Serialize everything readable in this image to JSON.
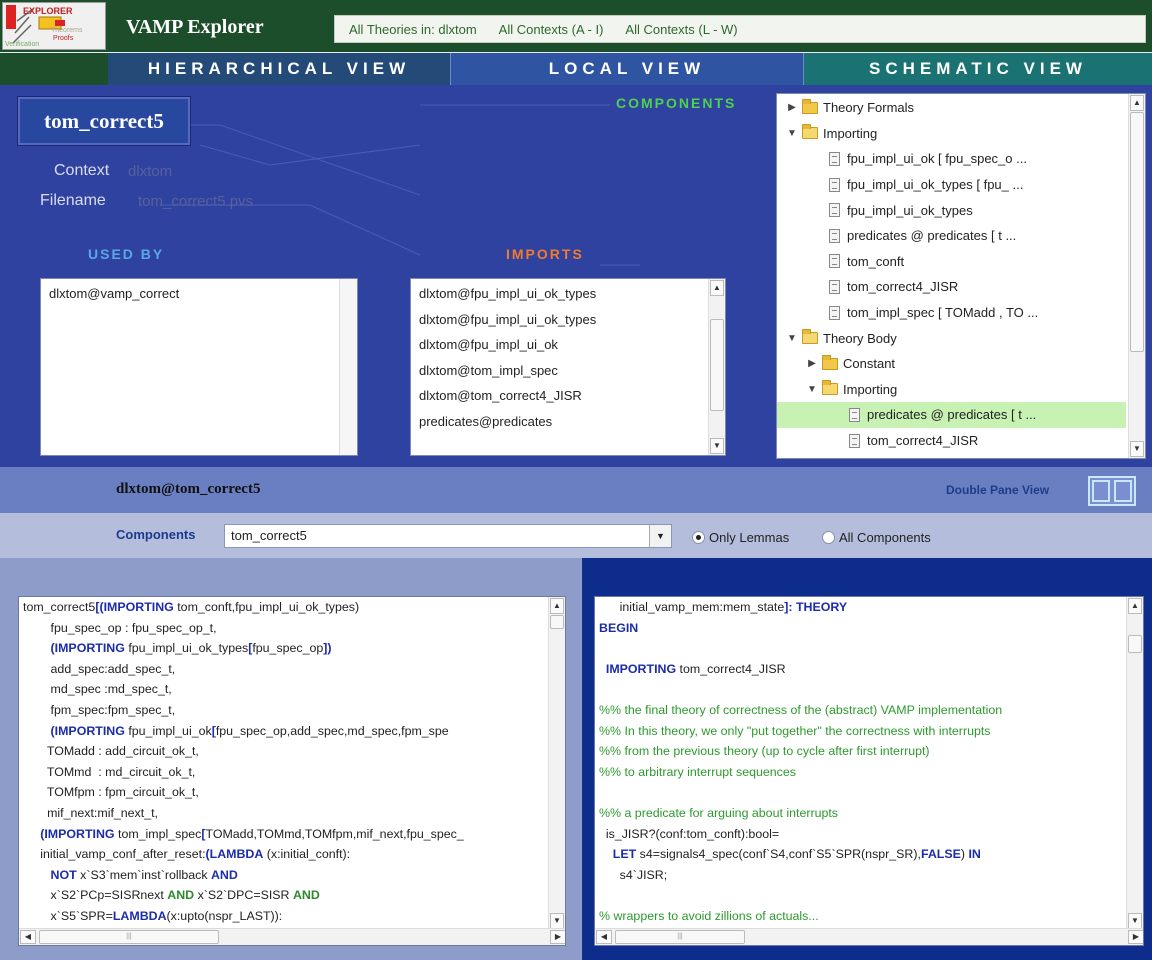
{
  "app": {
    "logo_text": "EXPLORER",
    "logo_sub1": "Theorems",
    "logo_sub2": "Proofs",
    "logo_sub3": "Verification",
    "title": "VAMP Explorer"
  },
  "top_links": [
    "All Theories in: dlxtom",
    "All Contexts (A - I)",
    "All Contexts (L - W)"
  ],
  "tabs": {
    "hierarchical": "HIERARCHICAL VIEW",
    "local": "LOCAL VIEW",
    "schematic": "SCHEMATIC VIEW"
  },
  "theory": {
    "name": "tom_correct5",
    "context_label": "Context",
    "context_value": "dlxtom",
    "filename_label": "Filename",
    "filename_value": "tom_correct5.pvs"
  },
  "sections": {
    "components": "COMPONENTS",
    "used_by": "USED BY",
    "imports": "IMPORTS"
  },
  "used_by": [
    "dlxtom@vamp_correct"
  ],
  "imports": [
    "dlxtom@fpu_impl_ui_ok_types",
    "dlxtom@fpu_impl_ui_ok_types",
    "dlxtom@fpu_impl_ui_ok",
    "dlxtom@tom_impl_spec",
    "dlxtom@tom_correct4_JISR",
    "predicates@predicates"
  ],
  "tree": [
    {
      "label": "Theory Formals",
      "kind": "folder",
      "depth": 0,
      "expanded": false
    },
    {
      "label": "Importing",
      "kind": "folder",
      "depth": 0,
      "expanded": true
    },
    {
      "label": "fpu_impl_ui_ok [ fpu_spec_o ...",
      "kind": "doc",
      "depth": 1
    },
    {
      "label": "fpu_impl_ui_ok_types [ fpu_ ...",
      "kind": "doc",
      "depth": 1
    },
    {
      "label": "fpu_impl_ui_ok_types",
      "kind": "doc",
      "depth": 1
    },
    {
      "label": "predicates @ predicates [ t ...",
      "kind": "doc",
      "depth": 1
    },
    {
      "label": "tom_conft",
      "kind": "doc",
      "depth": 1
    },
    {
      "label": "tom_correct4_JISR",
      "kind": "doc",
      "depth": 1
    },
    {
      "label": "tom_impl_spec [ TOMadd , TO ...",
      "kind": "doc",
      "depth": 1
    },
    {
      "label": "Theory Body",
      "kind": "folder",
      "depth": 0,
      "expanded": true
    },
    {
      "label": "Constant",
      "kind": "folder",
      "depth": 1,
      "expanded": false
    },
    {
      "label": "Importing",
      "kind": "folder",
      "depth": 1,
      "expanded": true
    },
    {
      "label": "predicates @ predicates [ t ...",
      "kind": "doc",
      "depth": 2,
      "selected": true
    },
    {
      "label": "tom_correct4_JISR",
      "kind": "doc",
      "depth": 2
    }
  ],
  "pane": {
    "title": "dlxtom@tom_correct5",
    "double_pane_label": "Double Pane View"
  },
  "components_bar": {
    "label": "Components",
    "selected": "tom_correct5",
    "radio_lemmas": "Only Lemmas",
    "radio_all": "All Components"
  },
  "left_code": [
    [
      {
        "t": "tom_correct5"
      },
      {
        "t": "[(",
        "c": "kw"
      },
      {
        "t": "IMPORTING",
        "c": "kw"
      },
      {
        "t": " tom_conft,fpu_impl_ui_ok_types)"
      }
    ],
    [
      {
        "t": "        fpu_spec_op : fpu_spec_op_t,"
      }
    ],
    [
      {
        "t": "        "
      },
      {
        "t": "(IMPORTING",
        "c": "kw"
      },
      {
        "t": " fpu_impl_ui_ok_types"
      },
      {
        "t": "[",
        "c": "kw"
      },
      {
        "t": "fpu_spec_op"
      },
      {
        "t": "])",
        "c": "kw"
      }
    ],
    [
      {
        "t": "        add_spec:add_spec_t,"
      }
    ],
    [
      {
        "t": "        md_spec :md_spec_t,"
      }
    ],
    [
      {
        "t": "        fpm_spec:fpm_spec_t,"
      }
    ],
    [
      {
        "t": "        "
      },
      {
        "t": "(IMPORTING",
        "c": "kw"
      },
      {
        "t": " fpu_impl_ui_ok"
      },
      {
        "t": "[",
        "c": "kw"
      },
      {
        "t": "fpu_spec_op,add_spec,md_spec,fpm_spe"
      }
    ],
    [
      {
        "t": "       TOMadd : add_circuit_ok_t,"
      }
    ],
    [
      {
        "t": "       TOMmd  : md_circuit_ok_t,"
      }
    ],
    [
      {
        "t": "       TOMfpm : fpm_circuit_ok_t,"
      }
    ],
    [
      {
        "t": "       mif_next:mif_next_t,"
      }
    ],
    [
      {
        "t": "     "
      },
      {
        "t": "(IMPORTING",
        "c": "kw"
      },
      {
        "t": " tom_impl_spec"
      },
      {
        "t": "[",
        "c": "kw"
      },
      {
        "t": "TOMadd,TOMmd,TOMfpm,mif_next,fpu_spec_"
      }
    ],
    [
      {
        "t": "     initial_vamp_conf_after_reset:"
      },
      {
        "t": "(LAMBDA",
        "c": "kw"
      },
      {
        "t": " (x:initial_conft):"
      }
    ],
    [
      {
        "t": "        "
      },
      {
        "t": "NOT",
        "c": "kw"
      },
      {
        "t": " x`S3`mem`inst`rollback "
      },
      {
        "t": "AND",
        "c": "kw"
      }
    ],
    [
      {
        "t": "        x`S2`PCp=SISRnext "
      },
      {
        "t": "AND",
        "c": "kwg"
      },
      {
        "t": " x`S2`DPC=SISR "
      },
      {
        "t": "AND",
        "c": "kwg"
      }
    ],
    [
      {
        "t": "        x`S5`SPR="
      },
      {
        "t": "LAMBDA",
        "c": "kw"
      },
      {
        "t": "(x:upto(nspr_LAST)):"
      }
    ]
  ],
  "right_code": [
    [
      {
        "t": "      initial_vamp_mem:mem_state"
      },
      {
        "t": "]: THEORY",
        "c": "kw"
      }
    ],
    [
      {
        "t": "BEGIN",
        "c": "kw"
      }
    ],
    [
      {
        "t": ""
      }
    ],
    [
      {
        "t": "  "
      },
      {
        "t": "IMPORTING",
        "c": "kw"
      },
      {
        "t": " tom_correct4_JISR"
      }
    ],
    [
      {
        "t": ""
      }
    ],
    [
      {
        "t": "%% the final theory of correctness of the (abstract) VAMP implementation",
        "c": "cm"
      }
    ],
    [
      {
        "t": "%% In this theory, we only \"put together\" the correctness with interrupts",
        "c": "cm"
      }
    ],
    [
      {
        "t": "%% from the previous theory (up to cycle after first interrupt)",
        "c": "cm"
      }
    ],
    [
      {
        "t": "%% to arbitrary interrupt sequences",
        "c": "cm"
      }
    ],
    [
      {
        "t": ""
      }
    ],
    [
      {
        "t": "%% a predicate for arguing about interrupts",
        "c": "cm"
      }
    ],
    [
      {
        "t": "  is_JISR?(conf:tom_conft):bool="
      }
    ],
    [
      {
        "t": "    "
      },
      {
        "t": "LET",
        "c": "kw"
      },
      {
        "t": " s4=signals4_spec(conf`S4,conf`S5`SPR(nspr_SR),"
      },
      {
        "t": "FALSE",
        "c": "kw"
      },
      {
        "t": ") "
      },
      {
        "t": "IN",
        "c": "kw"
      }
    ],
    [
      {
        "t": "      s4`JISR;"
      }
    ],
    [
      {
        "t": ""
      }
    ],
    [
      {
        "t": "% wrappers to avoid zillions of actuals...",
        "c": "cm"
      }
    ]
  ],
  "colors": {
    "header_green": "#1d4e2c",
    "info_blue": "#3042a0",
    "components_title": "#4cd24c",
    "used_by_title": "#58a8e8",
    "imports_title": "#f07a30",
    "keyword": "#1c2caa",
    "comment": "#2c9a2c"
  }
}
